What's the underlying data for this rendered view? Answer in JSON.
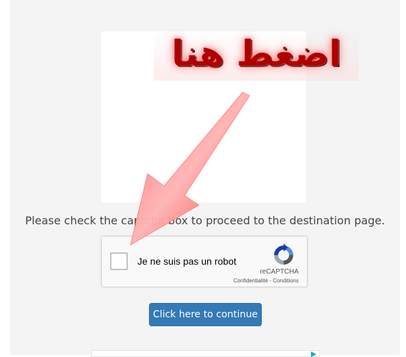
{
  "banner": {
    "text": "اضغط هنا"
  },
  "instruction": {
    "text": "Please check the captcha box to proceed to the destination page."
  },
  "captcha": {
    "label": "Je ne suis pas un robot",
    "brand": "reCAPTCHA",
    "links": "Confidentialité - Conditions",
    "checked": false
  },
  "continue_button": {
    "label": "Click here to continue"
  },
  "colors": {
    "accent": "#337ab7",
    "panel_bg": "#f4f4f4",
    "banner_red": "#b00000"
  }
}
